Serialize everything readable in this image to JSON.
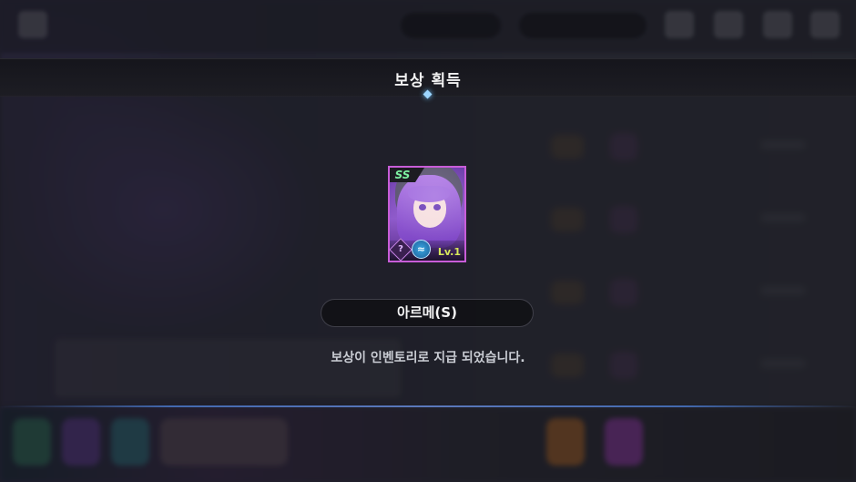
{
  "popup": {
    "title": "보상 획득",
    "item_name": "아르메(S)",
    "message": "보상이 인벤토리로 지급 되었습니다."
  },
  "reward_card": {
    "grade": "SS",
    "level": "Lv.1",
    "class_icon": "class-icon",
    "element_icon": "element-icon",
    "frame_color": "#c85dd8"
  },
  "colors": {
    "grade_text": "#7cf0a0",
    "level_text": "#d8e85a",
    "accent_line": "#6a8fe0"
  }
}
